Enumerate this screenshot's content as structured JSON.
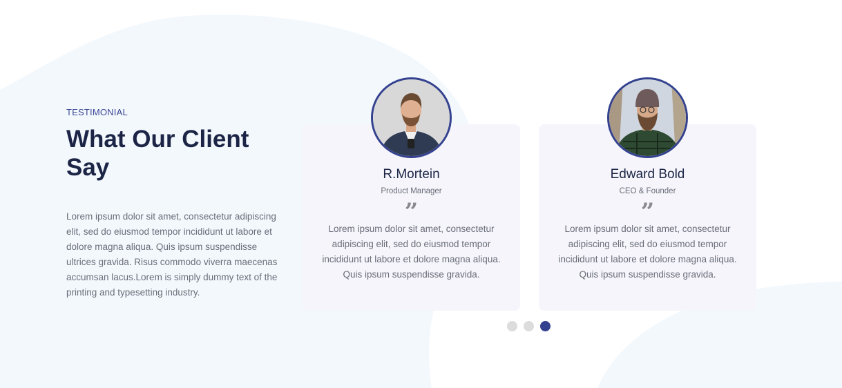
{
  "section": {
    "eyebrow": "TESTIMONIAL",
    "heading": "What Our Client Say",
    "intro": "Lorem ipsum dolor sit amet, consectetur adipiscing elit, sed do eiusmod tempor incididunt ut labore et dolore magna aliqua. Quis ipsum suspendisse ultrices gravida. Risus commodo viverra maecenas accumsan lacus.Lorem is simply dummy text of the printing and typesetting industry."
  },
  "testimonials": [
    {
      "name": "R.Mortein",
      "role": "Product Manager",
      "quote_icon": "quote-icon",
      "text": "Lorem ipsum dolor sit amet, consectetur adipiscing elit, sed do eiusmod tempor incididunt ut labore et dolore magna aliqua. Quis ipsum suspendisse gravida."
    },
    {
      "name": "Edward Bold",
      "role": "CEO & Founder",
      "quote_icon": "quote-icon",
      "text": "Lorem ipsum dolor sit amet, consectetur adipiscing elit, sed do eiusmod tempor incididunt ut labore et dolore magna aliqua. Quis ipsum suspendisse gravida."
    }
  ],
  "carousel": {
    "pages": 3,
    "active_page": 3
  },
  "colors": {
    "accent": "#33418f",
    "heading": "#1c2546",
    "body_text": "#6a6d78",
    "card_bg": "#f5f5fb",
    "blob": "#f3f8fd",
    "dot_inactive": "#dcdcdc"
  }
}
